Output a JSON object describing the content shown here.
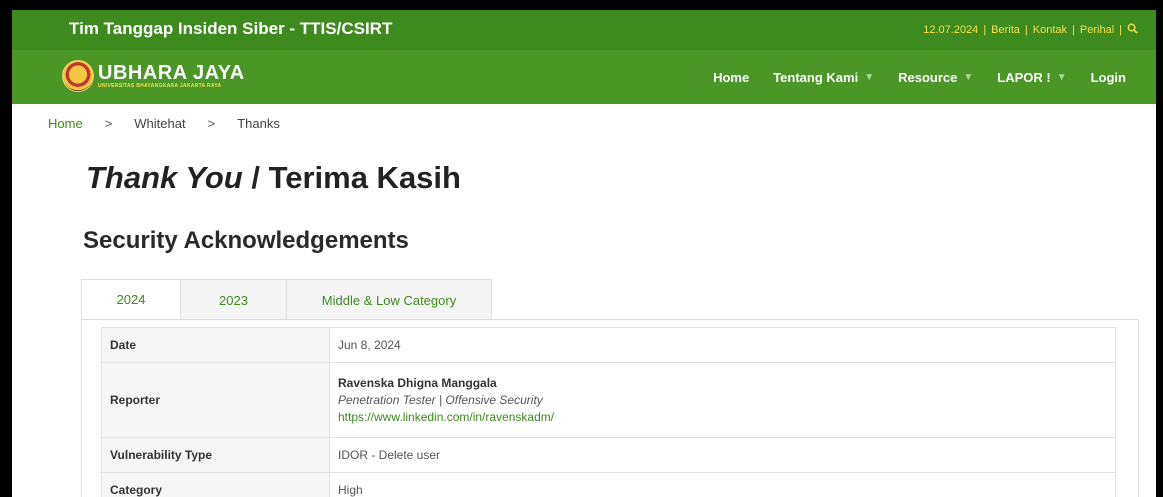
{
  "topbar": {
    "site_title": "Tim Tanggap Insiden Siber - TTIS/CSIRT",
    "date": "12.07.2024",
    "links": [
      "Berita",
      "Kontak",
      "Perihal"
    ],
    "separator": "|",
    "search_icon": "search-icon"
  },
  "logo": {
    "main": "UBHARA JAYA",
    "sub": "UNIVERSITAS BHAYANGKARA JAKARTA RAYA"
  },
  "nav": {
    "home": "Home",
    "tentang": "Tentang Kami",
    "resource": "Resource",
    "lapor": "LAPOR !",
    "login": "Login"
  },
  "breadcrumb": {
    "home": "Home",
    "middle": "Whitehat",
    "current": "Thanks",
    "arrow": ">"
  },
  "page": {
    "title_italic": "Thank You",
    "title_rest": " / Terima Kasih",
    "section": "Security Acknowledgements"
  },
  "tabs": {
    "t2024": "2024",
    "t2023": "2023",
    "middle": "Middle & Low Category"
  },
  "table": {
    "date_label": "Date",
    "date_value": "Jun 8, 2024",
    "reporter_label": "Reporter",
    "reporter_name": "Ravenska Dhigna Manggala",
    "reporter_role": "Penetration Tester | Offensive Security",
    "reporter_link": "https://www.linkedin.com/in/ravenskadm/",
    "vuln_label": "Vulnerability Type",
    "vuln_value": "IDOR - Delete user",
    "category_label": "Category",
    "category_value": "High"
  },
  "colors": {
    "topbar": "#3d8a1e",
    "navbar": "#4a9626",
    "accent_yellow": "#f0e24a",
    "link_green": "#3d8a1e"
  }
}
